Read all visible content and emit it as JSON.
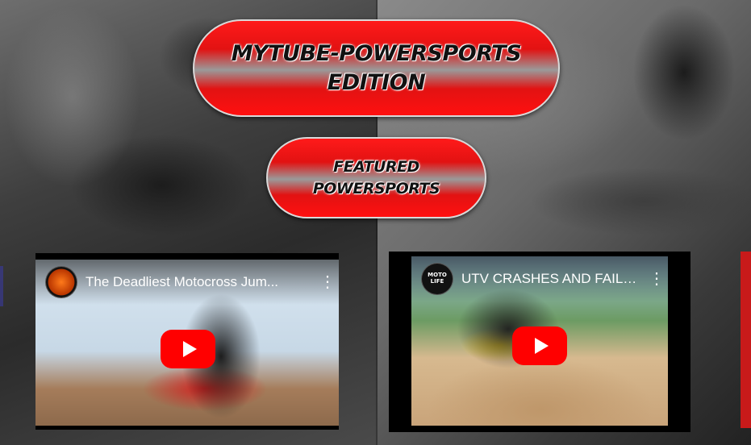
{
  "header": {
    "title": "MYTUBE-POWERSPORTS\nEDITION",
    "subtitle": "FEATURED\nPOWERSPORTS"
  },
  "videos": [
    {
      "title": "The Deadliest Motocross Jum...",
      "channel_avatar_icon": "rider-helmet-avatar",
      "play_icon": "youtube-play-icon",
      "menu_icon": "more-vert-icon"
    },
    {
      "title": "UTV CRASHES AND FAILS 20...",
      "channel_avatar_text": "MOTO LIFE",
      "play_icon": "youtube-play-icon",
      "menu_icon": "more-vert-icon"
    }
  ],
  "colors": {
    "pill_red": "#e21212",
    "youtube_red": "#ff0000"
  }
}
